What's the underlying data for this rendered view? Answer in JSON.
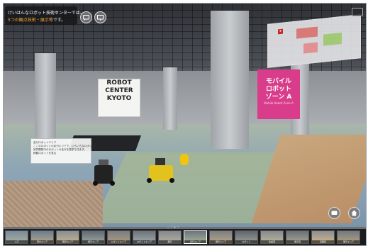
{
  "info": {
    "line1": "けいはんなロボット技術センターでは、",
    "line2_highlight": "5つの観点技術・展示等",
    "line2_rest": "です。"
  },
  "banner_robot_center": {
    "line1": "ROBOT",
    "line2": "CENTER",
    "line3": "KYOTO"
  },
  "banner_mobile": {
    "line1": "モバイル",
    "line2": "ロボット",
    "line3": "ゾーン A",
    "sub": "Mobile Robot Zone A"
  },
  "card": {
    "lines": [
      "走行ロボットエリア",
      "ここのロボットの走行エリアで、いろいろなロボットが",
      "研究開発中のロボットの走行を見学できます。",
      "移動ロボットを見る"
    ]
  },
  "icons": {
    "chat": "chat-bubble-icon",
    "screen": "screen-icon",
    "comment": "comment-icon",
    "home": "home-icon"
  },
  "thumbnails": [
    {
      "label": "入口"
    },
    {
      "label": "受付エリア"
    },
    {
      "label": "展示エリア"
    },
    {
      "label": "展示エリア"
    },
    {
      "label": "ロボットエリア"
    },
    {
      "label": "ロボットエリア"
    },
    {
      "label": "展示"
    },
    {
      "label": "走行エリア"
    },
    {
      "label": "展示エリア"
    },
    {
      "label": "ロボット"
    },
    {
      "label": "会議室"
    },
    {
      "label": "展示室"
    },
    {
      "label": "実験室"
    },
    {
      "label": "展示エリア"
    }
  ],
  "strip_controls": "− ‹ + ›",
  "colors": {
    "accent_orange": "#f2a83a",
    "banner_pink": "#d83c8a",
    "map_zone": "#d9534f"
  }
}
